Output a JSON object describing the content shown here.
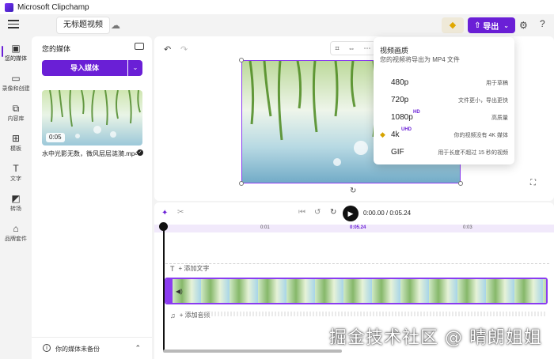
{
  "window": {
    "title": "Microsoft Clipchamp"
  },
  "topbar": {
    "project_title": "无标题视频",
    "export_label": "导出",
    "icons": {
      "menu": "hamburger-icon",
      "cloud": "cloud-off-icon",
      "premium": "diamond-icon",
      "settings": "people-icon",
      "help": "help-icon"
    }
  },
  "sidebar": {
    "items": [
      {
        "label": "您的媒体",
        "icon": "media-icon"
      },
      {
        "label": "录像和创建",
        "icon": "record-icon"
      },
      {
        "label": "内容库",
        "icon": "library-icon"
      },
      {
        "label": "模板",
        "icon": "templates-icon"
      },
      {
        "label": "文字",
        "icon": "text-icon"
      },
      {
        "label": "转场",
        "icon": "transitions-icon"
      },
      {
        "label": "品牌套件",
        "icon": "brand-kit-icon"
      }
    ]
  },
  "media_panel": {
    "title": "您的媒体",
    "import_label": "导入媒体",
    "clip": {
      "duration": "0:05",
      "name": "水中光影无数，微风层层涟漪.mp4"
    },
    "backup_text": "你的媒体未备份"
  },
  "preview": {
    "tools": [
      "crop-icon",
      "fit-icon",
      "more-icon"
    ]
  },
  "export_menu": {
    "title": "视频画质",
    "subtitle": "您的视频将导出为 MP4 文件",
    "options": [
      {
        "label": "480p",
        "badge": "",
        "note": "用于草稿"
      },
      {
        "label": "720p",
        "badge": "",
        "note": "文件更小，导出更快"
      },
      {
        "label": "1080p",
        "badge": "HD",
        "note": "高质量"
      },
      {
        "label": "4k",
        "badge": "UHD",
        "note": "你的视频没有 4K 媒体"
      },
      {
        "label": "GIF",
        "badge": "",
        "note": "用于长度不超过 15 秒的视频"
      }
    ]
  },
  "timeline": {
    "time_display": "0:00.00 / 0:05.24",
    "ticks": [
      "0:01",
      "0:05.24",
      "0:03"
    ],
    "add_text": "+ 添加文字",
    "add_audio": "+ 添加音频"
  },
  "watermark": "掘金技术社区 @ 晴朗姐姐",
  "colors": {
    "accent": "#6a1fd6",
    "selection": "#8b3cf0",
    "premium": "#e0a800"
  }
}
